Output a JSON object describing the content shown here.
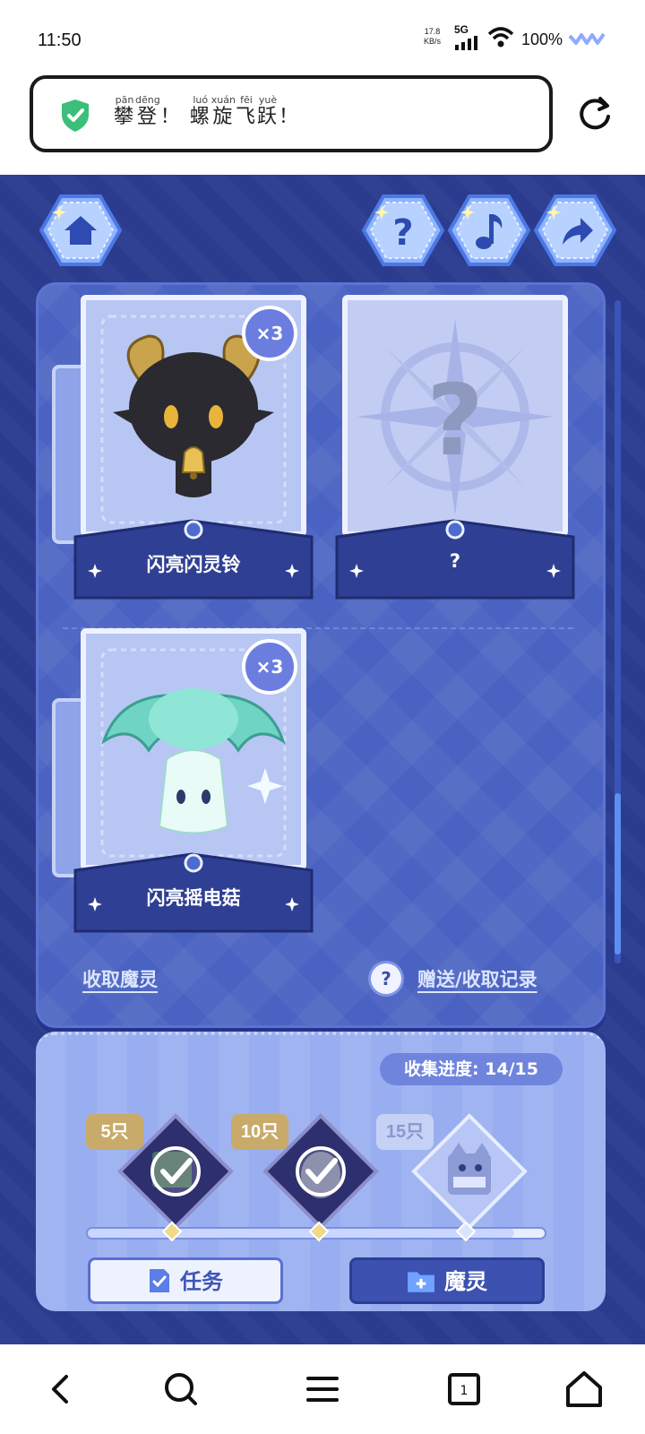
{
  "status_bar": {
    "time": "11:50",
    "net_speed_value": "17.8",
    "net_speed_unit": "KB/s",
    "signal_type": "5G",
    "battery": "100%"
  },
  "url_bar": {
    "title_words": [
      {
        "hanzi": "攀",
        "pinyin": "pān"
      },
      {
        "hanzi": "登",
        "pinyin": "dēng"
      },
      {
        "hanzi": "！",
        "pinyin": ""
      },
      {
        "hanzi": "螺",
        "pinyin": "luó"
      },
      {
        "hanzi": "旋",
        "pinyin": "xuán"
      },
      {
        "hanzi": "飞",
        "pinyin": "fēi"
      },
      {
        "hanzi": "跃",
        "pinyin": "yuè"
      },
      {
        "hanzi": "！",
        "pinyin": ""
      }
    ]
  },
  "top_icons": [
    "home-icon",
    "help-icon",
    "music-icon",
    "share-icon"
  ],
  "cards": [
    {
      "name": "闪亮闪灵铃",
      "badge": "×3",
      "unlocked": true
    },
    {
      "name": "?",
      "badge": "",
      "unlocked": false
    },
    {
      "name": "闪亮摇电菇",
      "badge": "×3",
      "unlocked": true
    }
  ],
  "links": {
    "collect": "收取魔灵",
    "history": "赠送/收取记录"
  },
  "progress": {
    "label": "收集进度: 14/15",
    "collected": 14,
    "total": 15,
    "rewards": [
      {
        "tag": "5只",
        "claimed": true
      },
      {
        "tag": "10只",
        "claimed": true
      },
      {
        "tag": "15只",
        "claimed": false
      }
    ]
  },
  "buttons": {
    "task": "任务",
    "spirit": "魔灵"
  },
  "nav": [
    "back-icon",
    "search-icon",
    "menu-icon",
    "tabs-icon",
    "home-icon"
  ],
  "nav_tab_count": "1",
  "colors": {
    "game_bg": "#2b3c8f",
    "panel": "#4a63c2",
    "accent": "#6b7ee0",
    "shield_green": "#3bbf7a"
  }
}
